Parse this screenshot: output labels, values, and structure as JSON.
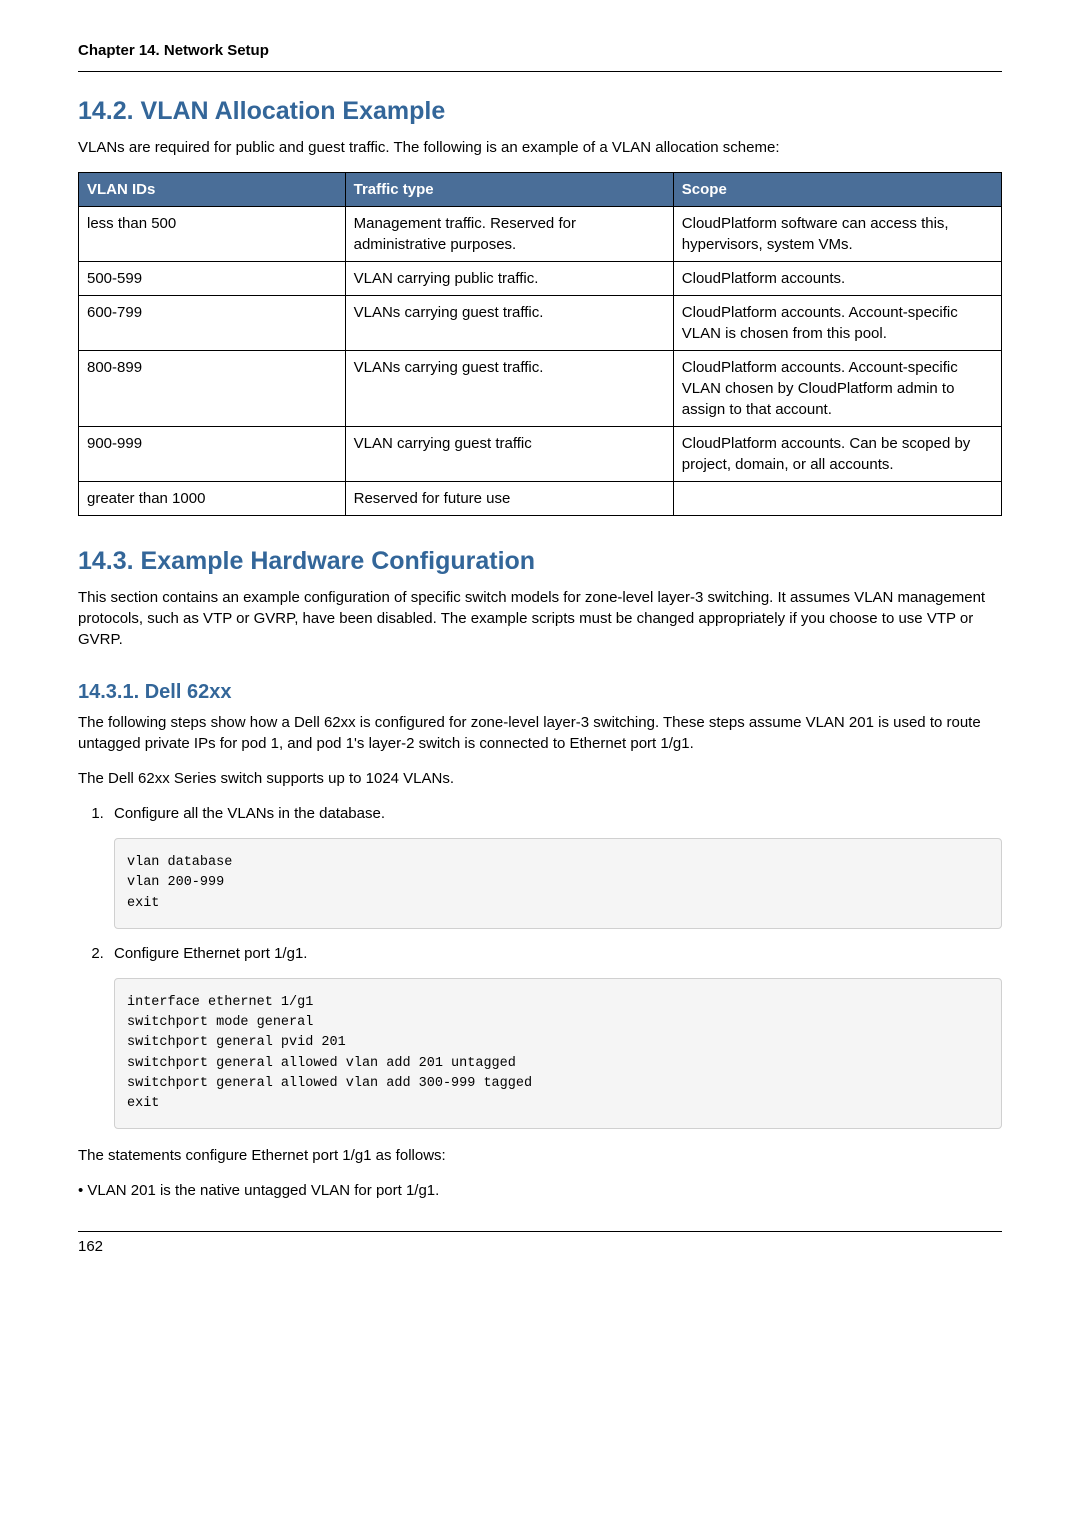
{
  "chapter_header": "Chapter 14. Network Setup",
  "section_14_2": {
    "heading": "14.2. VLAN Allocation Example",
    "intro": "VLANs are required for public and guest traffic. The following is an example of a VLAN allocation scheme:",
    "table": {
      "headers": [
        "VLAN IDs",
        "Traffic type",
        "Scope"
      ],
      "rows": [
        [
          "less than 500",
          "Management traffic. Reserved for administrative purposes.",
          "CloudPlatform software can access this, hypervisors, system VMs."
        ],
        [
          "500-599",
          "VLAN carrying public traffic.",
          "CloudPlatform accounts."
        ],
        [
          "600-799",
          "VLANs carrying guest traffic.",
          "CloudPlatform accounts. Account-specific VLAN is chosen from this pool."
        ],
        [
          "800-899",
          "VLANs carrying guest traffic.",
          "CloudPlatform accounts. Account-specific VLAN chosen by CloudPlatform admin to assign to that account."
        ],
        [
          "900-999",
          "VLAN carrying guest traffic",
          "CloudPlatform accounts. Can be scoped by project, domain, or all accounts."
        ],
        [
          "greater than 1000",
          "Reserved for future use",
          ""
        ]
      ]
    }
  },
  "section_14_3": {
    "heading": "14.3. Example Hardware Configuration",
    "intro": "This section contains an example configuration of specific switch models for zone-level layer-3 switching. It assumes VLAN management protocols, such as VTP or GVRP, have been disabled. The example scripts must be changed appropriately if you choose to use VTP or GVRP."
  },
  "section_14_3_1": {
    "heading": "14.3.1. Dell 62xx",
    "para1": "The following steps show how a Dell 62xx is configured for zone-level layer-3 switching. These steps assume VLAN 201 is used to route untagged private IPs for pod 1, and pod 1's layer-2 switch is connected to Ethernet port 1/g1.",
    "para2": "The Dell 62xx Series switch supports up to 1024 VLANs.",
    "step1_label": "Configure all the VLANs in the database.",
    "step1_code": "vlan database\nvlan 200-999\nexit",
    "step2_label": "Configure Ethernet port 1/g1.",
    "step2_code": "interface ethernet 1/g1\nswitchport mode general\nswitchport general pvid 201\nswitchport general allowed vlan add 201 untagged\nswitchport general allowed vlan add 300-999 tagged\nexit",
    "after_steps": "The statements configure Ethernet port 1/g1 as follows:",
    "bullet1": "VLAN 201 is the native untagged VLAN for port 1/g1."
  },
  "page_number": "162"
}
